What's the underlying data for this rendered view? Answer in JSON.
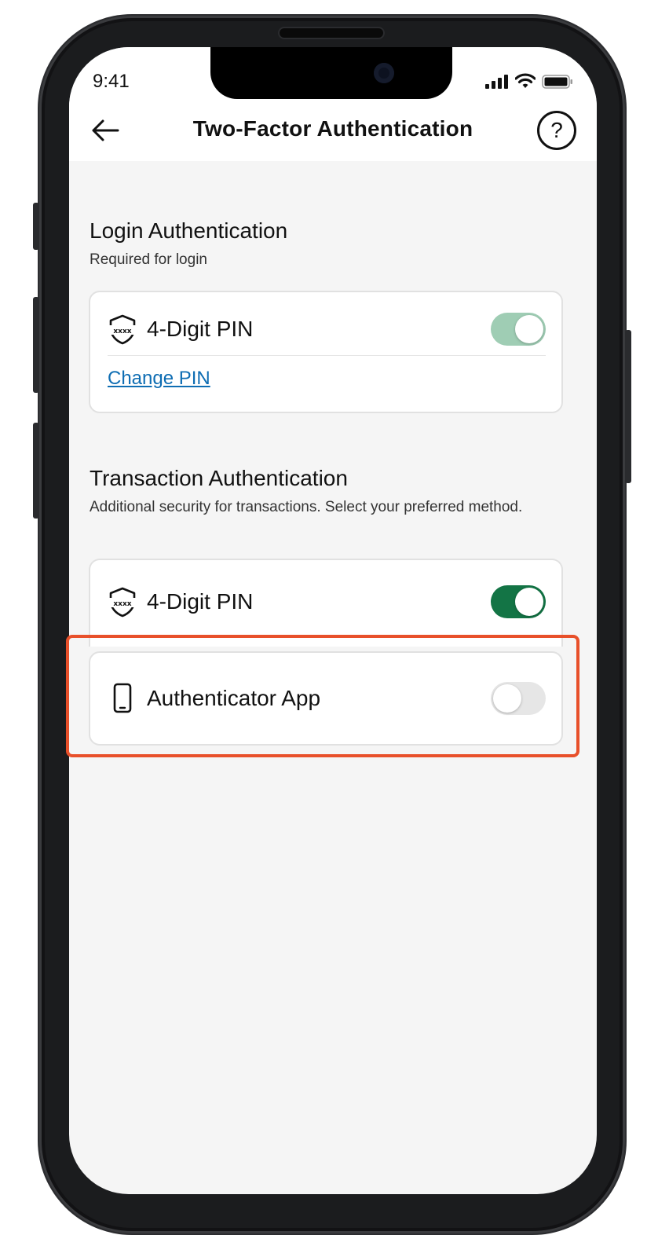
{
  "status_bar": {
    "time": "9:41"
  },
  "header": {
    "title": "Two-Factor Authentication"
  },
  "login_section": {
    "title": "Login Authentication",
    "subtitle": "Required for login",
    "pin_option": {
      "label": "4-Digit PIN",
      "enabled": true
    },
    "change_pin_link": "Change PIN"
  },
  "transaction_section": {
    "title": "Transaction Authentication",
    "subtitle": "Additional security for transactions. Select your preferred method.",
    "pin_option": {
      "label": "4-Digit PIN",
      "enabled": true
    },
    "authenticator_option": {
      "label": "Authenticator App",
      "enabled": false
    }
  },
  "icons": {
    "back": "arrow-left-icon",
    "help": "question-circle-icon",
    "pin": "shield-pin-icon",
    "authenticator": "smartphone-icon"
  },
  "colors": {
    "toggle_on": "#137445",
    "toggle_on_light": "#9fcdb4",
    "toggle_off": "#e6e6e6",
    "link": "#0e6db3",
    "highlight": "#e8502a"
  }
}
